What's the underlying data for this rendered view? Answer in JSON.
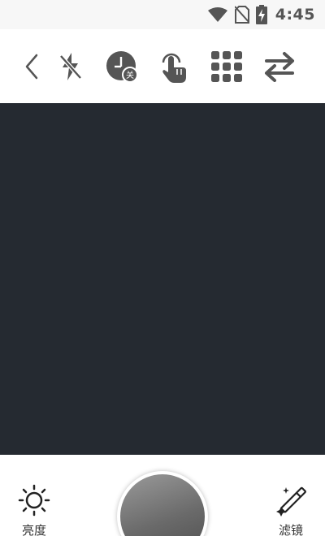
{
  "status_bar": {
    "time": "4:45",
    "icons": [
      "wifi-icon",
      "no-sim-icon",
      "battery-charging-icon"
    ]
  },
  "toolbar": {
    "icons": [
      "back-icon",
      "flash-off-icon",
      "timer-off-icon",
      "touch-capture-icon",
      "grid-icon",
      "switch-camera-icon"
    ],
    "timer_badge": "关"
  },
  "bottom_bar": {
    "left_label": "亮度",
    "right_label": "滤镜",
    "left_icon": "brightness-icon",
    "right_icon": "filter-wand-icon"
  },
  "colors": {
    "viewfinder": "#252a31",
    "icon": "#555555"
  }
}
